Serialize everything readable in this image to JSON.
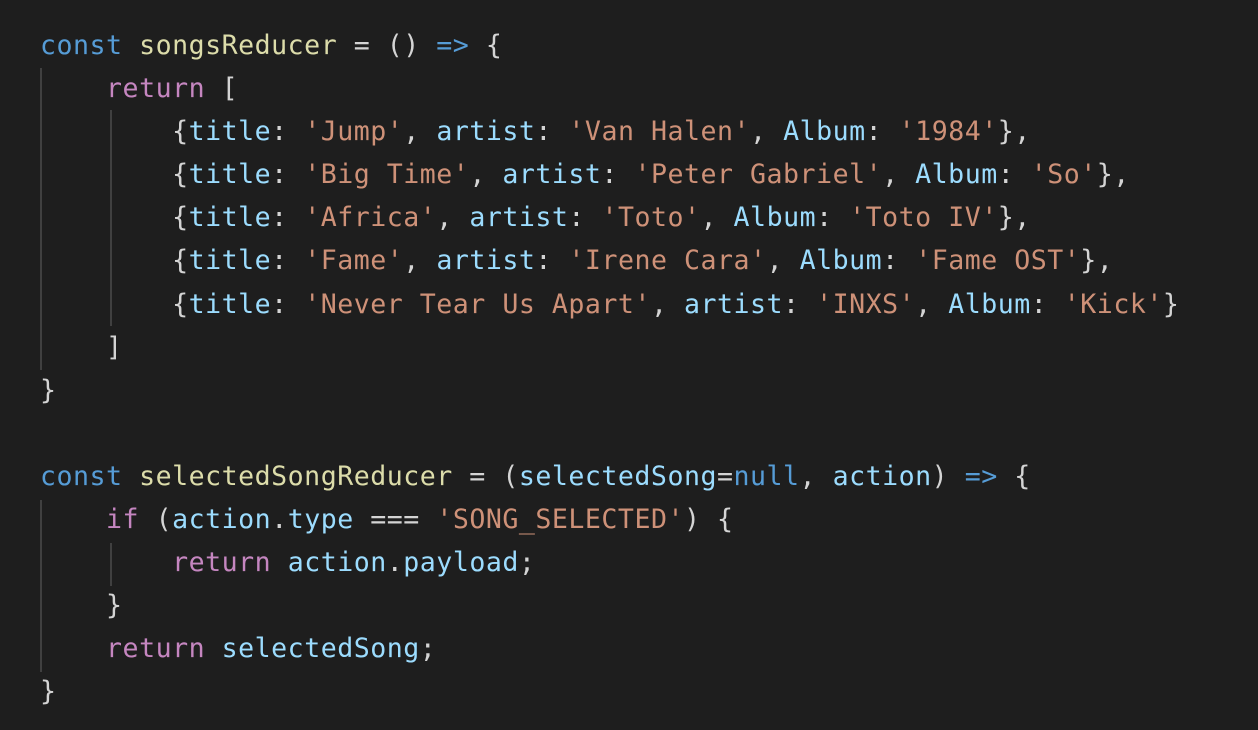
{
  "colors": {
    "background": "#1e1e1e",
    "keyword": "#569cd6",
    "control": "#c586c0",
    "function": "#dcdcaa",
    "variable": "#9cdcfe",
    "string": "#ce9178",
    "punctuation": "#d4d4d4",
    "indent_guide": "#404040"
  },
  "editor": {
    "language": "javascript",
    "lines": [
      {
        "tokens": [
          {
            "t": "const",
            "c": "kw"
          },
          {
            "t": " ",
            "c": "pun"
          },
          {
            "t": "songsReducer",
            "c": "fn"
          },
          {
            "t": " = () ",
            "c": "pun"
          },
          {
            "t": "=>",
            "c": "kw"
          },
          {
            "t": " {",
            "c": "pun"
          }
        ]
      },
      {
        "tokens": [
          {
            "t": "    ",
            "c": "pun"
          },
          {
            "t": "return",
            "c": "ctl"
          },
          {
            "t": " [",
            "c": "pun"
          }
        ]
      },
      {
        "tokens": [
          {
            "t": "        {",
            "c": "pun"
          },
          {
            "t": "title",
            "c": "var"
          },
          {
            "t": ": ",
            "c": "pun"
          },
          {
            "t": "'Jump'",
            "c": "str"
          },
          {
            "t": ", ",
            "c": "pun"
          },
          {
            "t": "artist",
            "c": "var"
          },
          {
            "t": ": ",
            "c": "pun"
          },
          {
            "t": "'Van Halen'",
            "c": "str"
          },
          {
            "t": ", ",
            "c": "pun"
          },
          {
            "t": "Album",
            "c": "var"
          },
          {
            "t": ": ",
            "c": "pun"
          },
          {
            "t": "'1984'",
            "c": "str"
          },
          {
            "t": "},",
            "c": "pun"
          }
        ]
      },
      {
        "tokens": [
          {
            "t": "        {",
            "c": "pun"
          },
          {
            "t": "title",
            "c": "var"
          },
          {
            "t": ": ",
            "c": "pun"
          },
          {
            "t": "'Big Time'",
            "c": "str"
          },
          {
            "t": ", ",
            "c": "pun"
          },
          {
            "t": "artist",
            "c": "var"
          },
          {
            "t": ": ",
            "c": "pun"
          },
          {
            "t": "'Peter Gabriel'",
            "c": "str"
          },
          {
            "t": ", ",
            "c": "pun"
          },
          {
            "t": "Album",
            "c": "var"
          },
          {
            "t": ": ",
            "c": "pun"
          },
          {
            "t": "'So'",
            "c": "str"
          },
          {
            "t": "},",
            "c": "pun"
          }
        ]
      },
      {
        "tokens": [
          {
            "t": "        {",
            "c": "pun"
          },
          {
            "t": "title",
            "c": "var"
          },
          {
            "t": ": ",
            "c": "pun"
          },
          {
            "t": "'Africa'",
            "c": "str"
          },
          {
            "t": ", ",
            "c": "pun"
          },
          {
            "t": "artist",
            "c": "var"
          },
          {
            "t": ": ",
            "c": "pun"
          },
          {
            "t": "'Toto'",
            "c": "str"
          },
          {
            "t": ", ",
            "c": "pun"
          },
          {
            "t": "Album",
            "c": "var"
          },
          {
            "t": ": ",
            "c": "pun"
          },
          {
            "t": "'Toto IV'",
            "c": "str"
          },
          {
            "t": "},",
            "c": "pun"
          }
        ]
      },
      {
        "tokens": [
          {
            "t": "        {",
            "c": "pun"
          },
          {
            "t": "title",
            "c": "var"
          },
          {
            "t": ": ",
            "c": "pun"
          },
          {
            "t": "'Fame'",
            "c": "str"
          },
          {
            "t": ", ",
            "c": "pun"
          },
          {
            "t": "artist",
            "c": "var"
          },
          {
            "t": ": ",
            "c": "pun"
          },
          {
            "t": "'Irene Cara'",
            "c": "str"
          },
          {
            "t": ", ",
            "c": "pun"
          },
          {
            "t": "Album",
            "c": "var"
          },
          {
            "t": ": ",
            "c": "pun"
          },
          {
            "t": "'Fame OST'",
            "c": "str"
          },
          {
            "t": "},",
            "c": "pun"
          }
        ]
      },
      {
        "tokens": [
          {
            "t": "        {",
            "c": "pun"
          },
          {
            "t": "title",
            "c": "var"
          },
          {
            "t": ": ",
            "c": "pun"
          },
          {
            "t": "'Never Tear Us Apart'",
            "c": "str"
          },
          {
            "t": ", ",
            "c": "pun"
          },
          {
            "t": "artist",
            "c": "var"
          },
          {
            "t": ": ",
            "c": "pun"
          },
          {
            "t": "'INXS'",
            "c": "str"
          },
          {
            "t": ", ",
            "c": "pun"
          },
          {
            "t": "Album",
            "c": "var"
          },
          {
            "t": ": ",
            "c": "pun"
          },
          {
            "t": "'Kick'",
            "c": "str"
          },
          {
            "t": "}",
            "c": "pun"
          }
        ]
      },
      {
        "tokens": [
          {
            "t": "    ]",
            "c": "pun"
          }
        ]
      },
      {
        "tokens": [
          {
            "t": "}",
            "c": "pun"
          }
        ]
      },
      {
        "tokens": []
      },
      {
        "tokens": [
          {
            "t": "const",
            "c": "kw"
          },
          {
            "t": " ",
            "c": "pun"
          },
          {
            "t": "selectedSongReducer",
            "c": "fn"
          },
          {
            "t": " = (",
            "c": "pun"
          },
          {
            "t": "selectedSong",
            "c": "var"
          },
          {
            "t": "=",
            "c": "pun"
          },
          {
            "t": "null",
            "c": "kw"
          },
          {
            "t": ", ",
            "c": "pun"
          },
          {
            "t": "action",
            "c": "var"
          },
          {
            "t": ") ",
            "c": "pun"
          },
          {
            "t": "=>",
            "c": "kw"
          },
          {
            "t": " {",
            "c": "pun"
          }
        ]
      },
      {
        "tokens": [
          {
            "t": "    ",
            "c": "pun"
          },
          {
            "t": "if",
            "c": "ctl"
          },
          {
            "t": " (",
            "c": "pun"
          },
          {
            "t": "action",
            "c": "var"
          },
          {
            "t": ".",
            "c": "pun"
          },
          {
            "t": "type",
            "c": "var"
          },
          {
            "t": " === ",
            "c": "pun"
          },
          {
            "t": "'SONG_SELECTED'",
            "c": "str"
          },
          {
            "t": ") {",
            "c": "pun"
          }
        ]
      },
      {
        "tokens": [
          {
            "t": "        ",
            "c": "pun"
          },
          {
            "t": "return",
            "c": "ctl"
          },
          {
            "t": " ",
            "c": "pun"
          },
          {
            "t": "action",
            "c": "var"
          },
          {
            "t": ".",
            "c": "pun"
          },
          {
            "t": "payload",
            "c": "var"
          },
          {
            "t": ";",
            "c": "pun"
          }
        ]
      },
      {
        "tokens": [
          {
            "t": "    }",
            "c": "pun"
          }
        ]
      },
      {
        "tokens": [
          {
            "t": "    ",
            "c": "pun"
          },
          {
            "t": "return",
            "c": "ctl"
          },
          {
            "t": " ",
            "c": "pun"
          },
          {
            "t": "selectedSong",
            "c": "var"
          },
          {
            "t": ";",
            "c": "pun"
          }
        ]
      },
      {
        "tokens": [
          {
            "t": "}",
            "c": "pun"
          }
        ]
      }
    ]
  }
}
